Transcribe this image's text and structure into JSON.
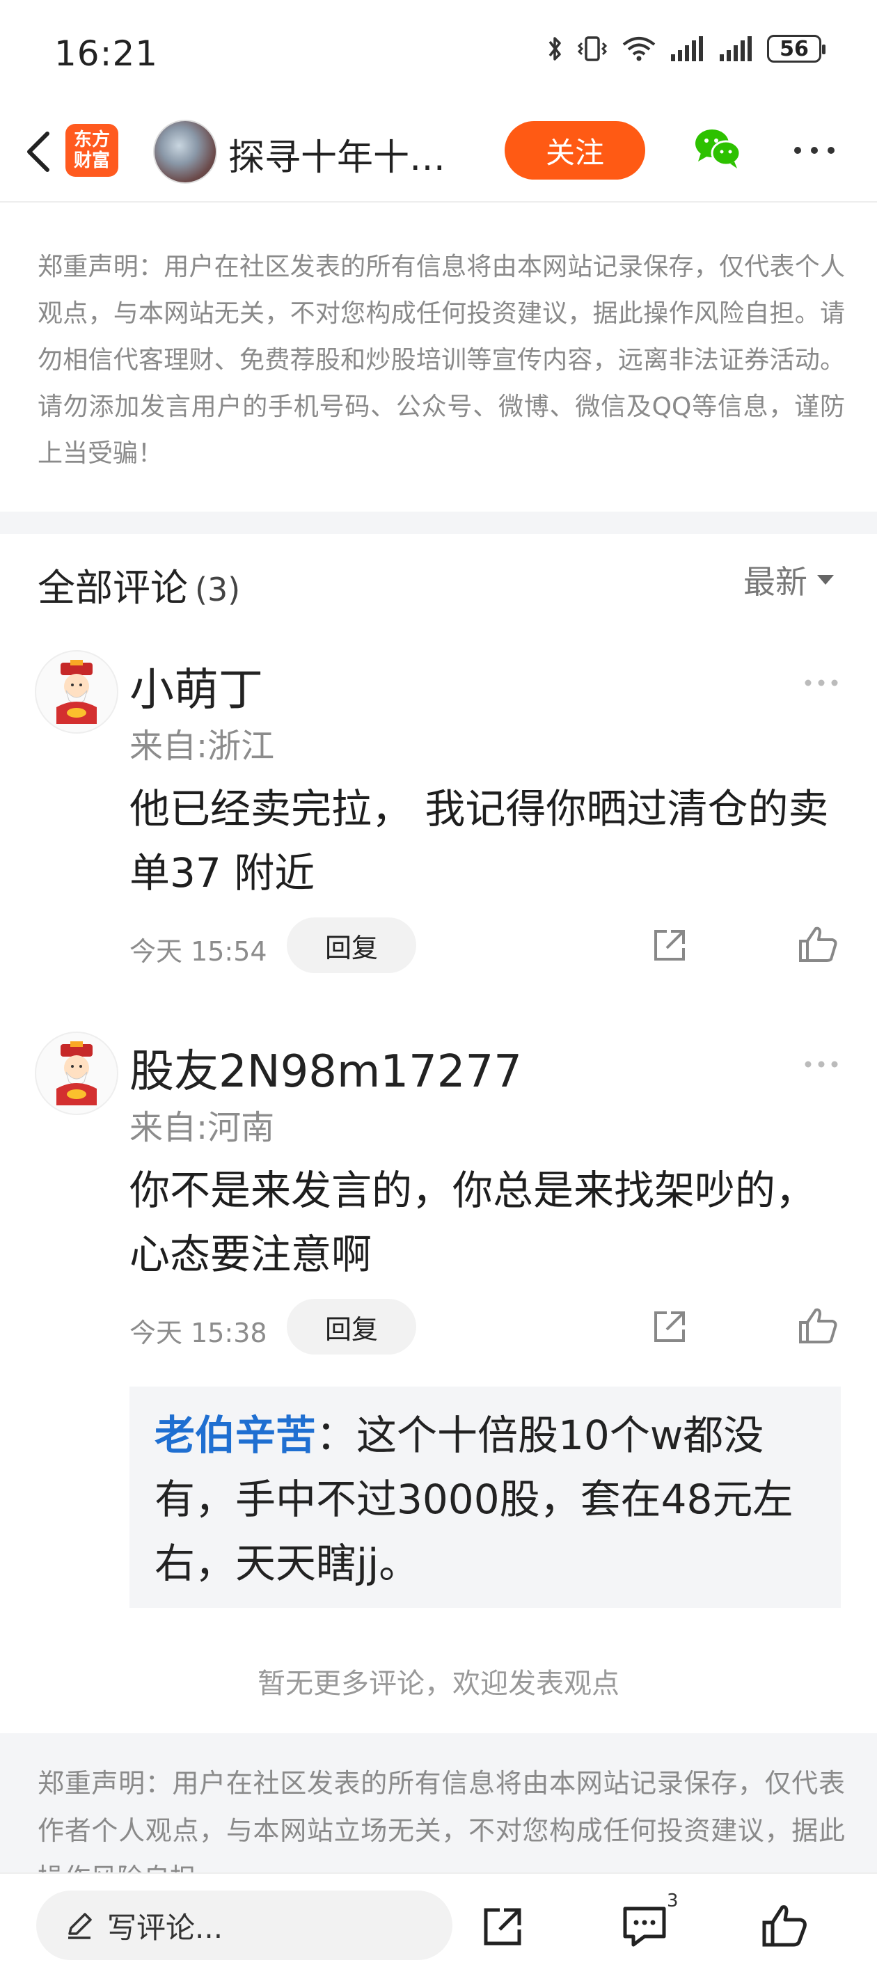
{
  "status_bar": {
    "time": "16:21",
    "battery": "56",
    "icons": [
      "bluetooth-icon",
      "vibrate-icon",
      "wifi-icon",
      "signal-icon",
      "signal-icon",
      "battery-icon"
    ]
  },
  "nav": {
    "logo_line1": "东方",
    "logo_line2": "财富",
    "title": "探寻十年十…",
    "follow_label": "关注"
  },
  "disclaimer_top": "郑重声明：用户在社区发表的所有信息将由本网站记录保存，仅代表个人观点，与本网站无关，不对您构成任何投资建议，据此操作风险自担。请勿相信代客理财、免费荐股和炒股培训等宣传内容，远离非法证券活动。请勿添加发言用户的手机号码、公众号、微博、微信及QQ等信息，谨防上当受骗！",
  "comments_header": {
    "title": "全部评论",
    "count": "(3)",
    "sort": "最新"
  },
  "comments": [
    {
      "name": "小萌丁",
      "location": "来自:浙江",
      "text": "他已经卖完拉， 我记得你晒过清仓的卖单37 附近",
      "time": "今天 15:54",
      "reply_label": "回复"
    },
    {
      "name": "股友2N98m17277",
      "location": "来自:河南",
      "text": "你不是来发言的，你总是来找架吵的，心态要注意啊",
      "time": "今天 15:38",
      "reply_label": "回复"
    }
  ],
  "quote": {
    "user": "老伯辛苦",
    "text": "：这个十倍股10个w都没有，手中不过3000股，套在48元左右，天天瞎jj。"
  },
  "no_more": "暂无更多评论，欢迎发表观点",
  "disclaimer_bottom": "郑重声明：用户在社区发表的所有信息将由本网站记录保存，仅代表作者个人观点，与本网站立场无关，不对您构成任何投资建议，据此操作风险自担。",
  "bottom_bar": {
    "input_placeholder": "写评论...",
    "comment_badge": "3"
  },
  "colors": {
    "accent": "#ff5a14",
    "link_blue": "#1f6fd1",
    "muted": "#8c8c8c"
  }
}
